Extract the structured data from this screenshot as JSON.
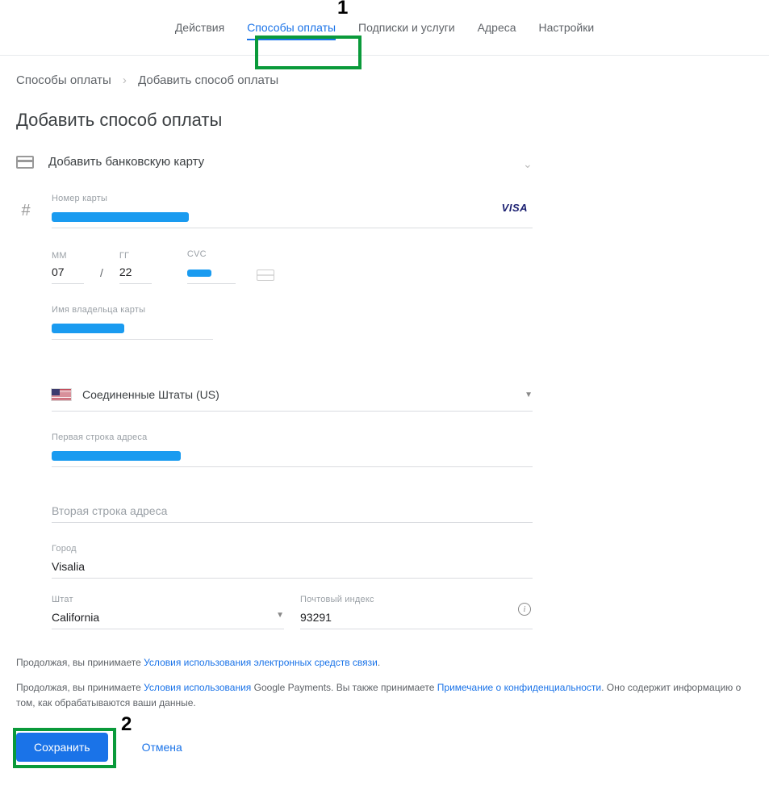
{
  "annotations": {
    "n1": "1",
    "n2": "2"
  },
  "nav": {
    "actions": "Действия",
    "payment_methods": "Способы оплаты",
    "subscriptions": "Подписки и услуги",
    "addresses": "Адреса",
    "settings": "Настройки"
  },
  "breadcrumb": {
    "parent": "Способы оплаты",
    "current": "Добавить способ оплаты"
  },
  "page_title": "Добавить способ оплаты",
  "method": {
    "add_card": "Добавить банковскую карту"
  },
  "card": {
    "number_label": "Номер карты",
    "mm_label": "ММ",
    "mm_value": "07",
    "yy_label": "ГГ",
    "yy_value": "22",
    "cvc_label": "CVC",
    "name_label": "Имя владельца карты",
    "brand": "VISA"
  },
  "country": {
    "value": "Соединенные Штаты (US)"
  },
  "address": {
    "line1_label": "Первая строка адреса",
    "line2_placeholder": "Вторая строка адреса",
    "city_label": "Город",
    "city_value": "Visalia",
    "state_label": "Штат",
    "state_value": "California",
    "postal_label": "Почтовый индекс",
    "postal_value": "93291"
  },
  "terms": {
    "t1_pre": "Продолжая, вы принимаете ",
    "t1_link": "Условия использования электронных средств связи",
    "t1_post": ".",
    "t2_pre": "Продолжая, вы принимаете ",
    "t2_link1": "Условия использования",
    "t2_mid": " Google Payments. Вы также принимаете ",
    "t2_link2": "Примечание о конфиденциальности",
    "t2_post": ". Оно содержит информацию о том, как обрабатываются ваши данные."
  },
  "buttons": {
    "save": "Сохранить",
    "cancel": "Отмена"
  }
}
